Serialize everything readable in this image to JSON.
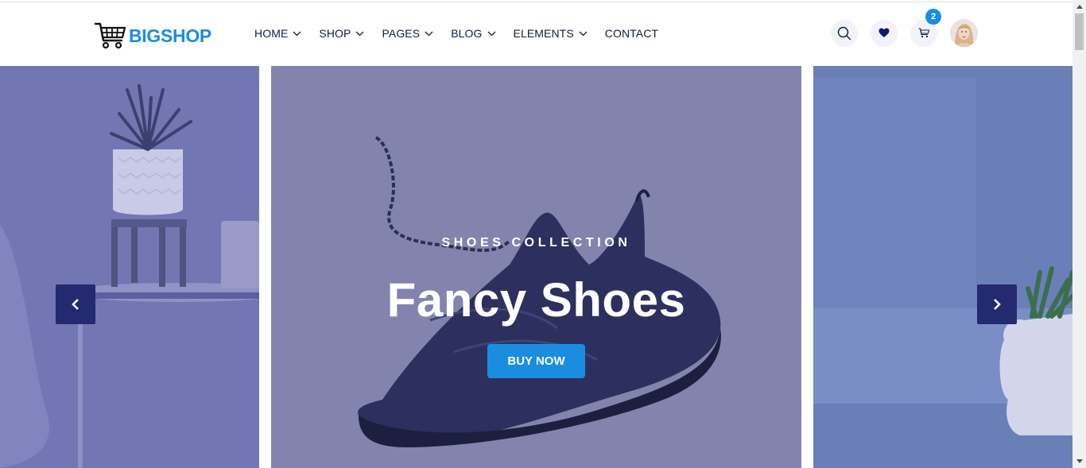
{
  "brand": {
    "name": "BIGSHOP"
  },
  "nav": {
    "items": [
      {
        "label": "HOME",
        "has_dropdown": true
      },
      {
        "label": "SHOP",
        "has_dropdown": true
      },
      {
        "label": "PAGES",
        "has_dropdown": true
      },
      {
        "label": "BLOG",
        "has_dropdown": true
      },
      {
        "label": "ELEMENTS",
        "has_dropdown": true
      },
      {
        "label": "CONTACT",
        "has_dropdown": false
      }
    ]
  },
  "header_icons": {
    "search": "search-icon",
    "wishlist": "heart-icon",
    "cart": "cart-icon",
    "cart_count": "2"
  },
  "hero": {
    "kicker": "SHOES COLLECTION",
    "headline": "Fancy Shoes",
    "cta_label": "BUY NOW"
  },
  "colors": {
    "brand_blue": "#1a8de0",
    "nav_text": "#0f1a45",
    "arrow_bg": "#232a70",
    "overlay": "#8384ad"
  }
}
